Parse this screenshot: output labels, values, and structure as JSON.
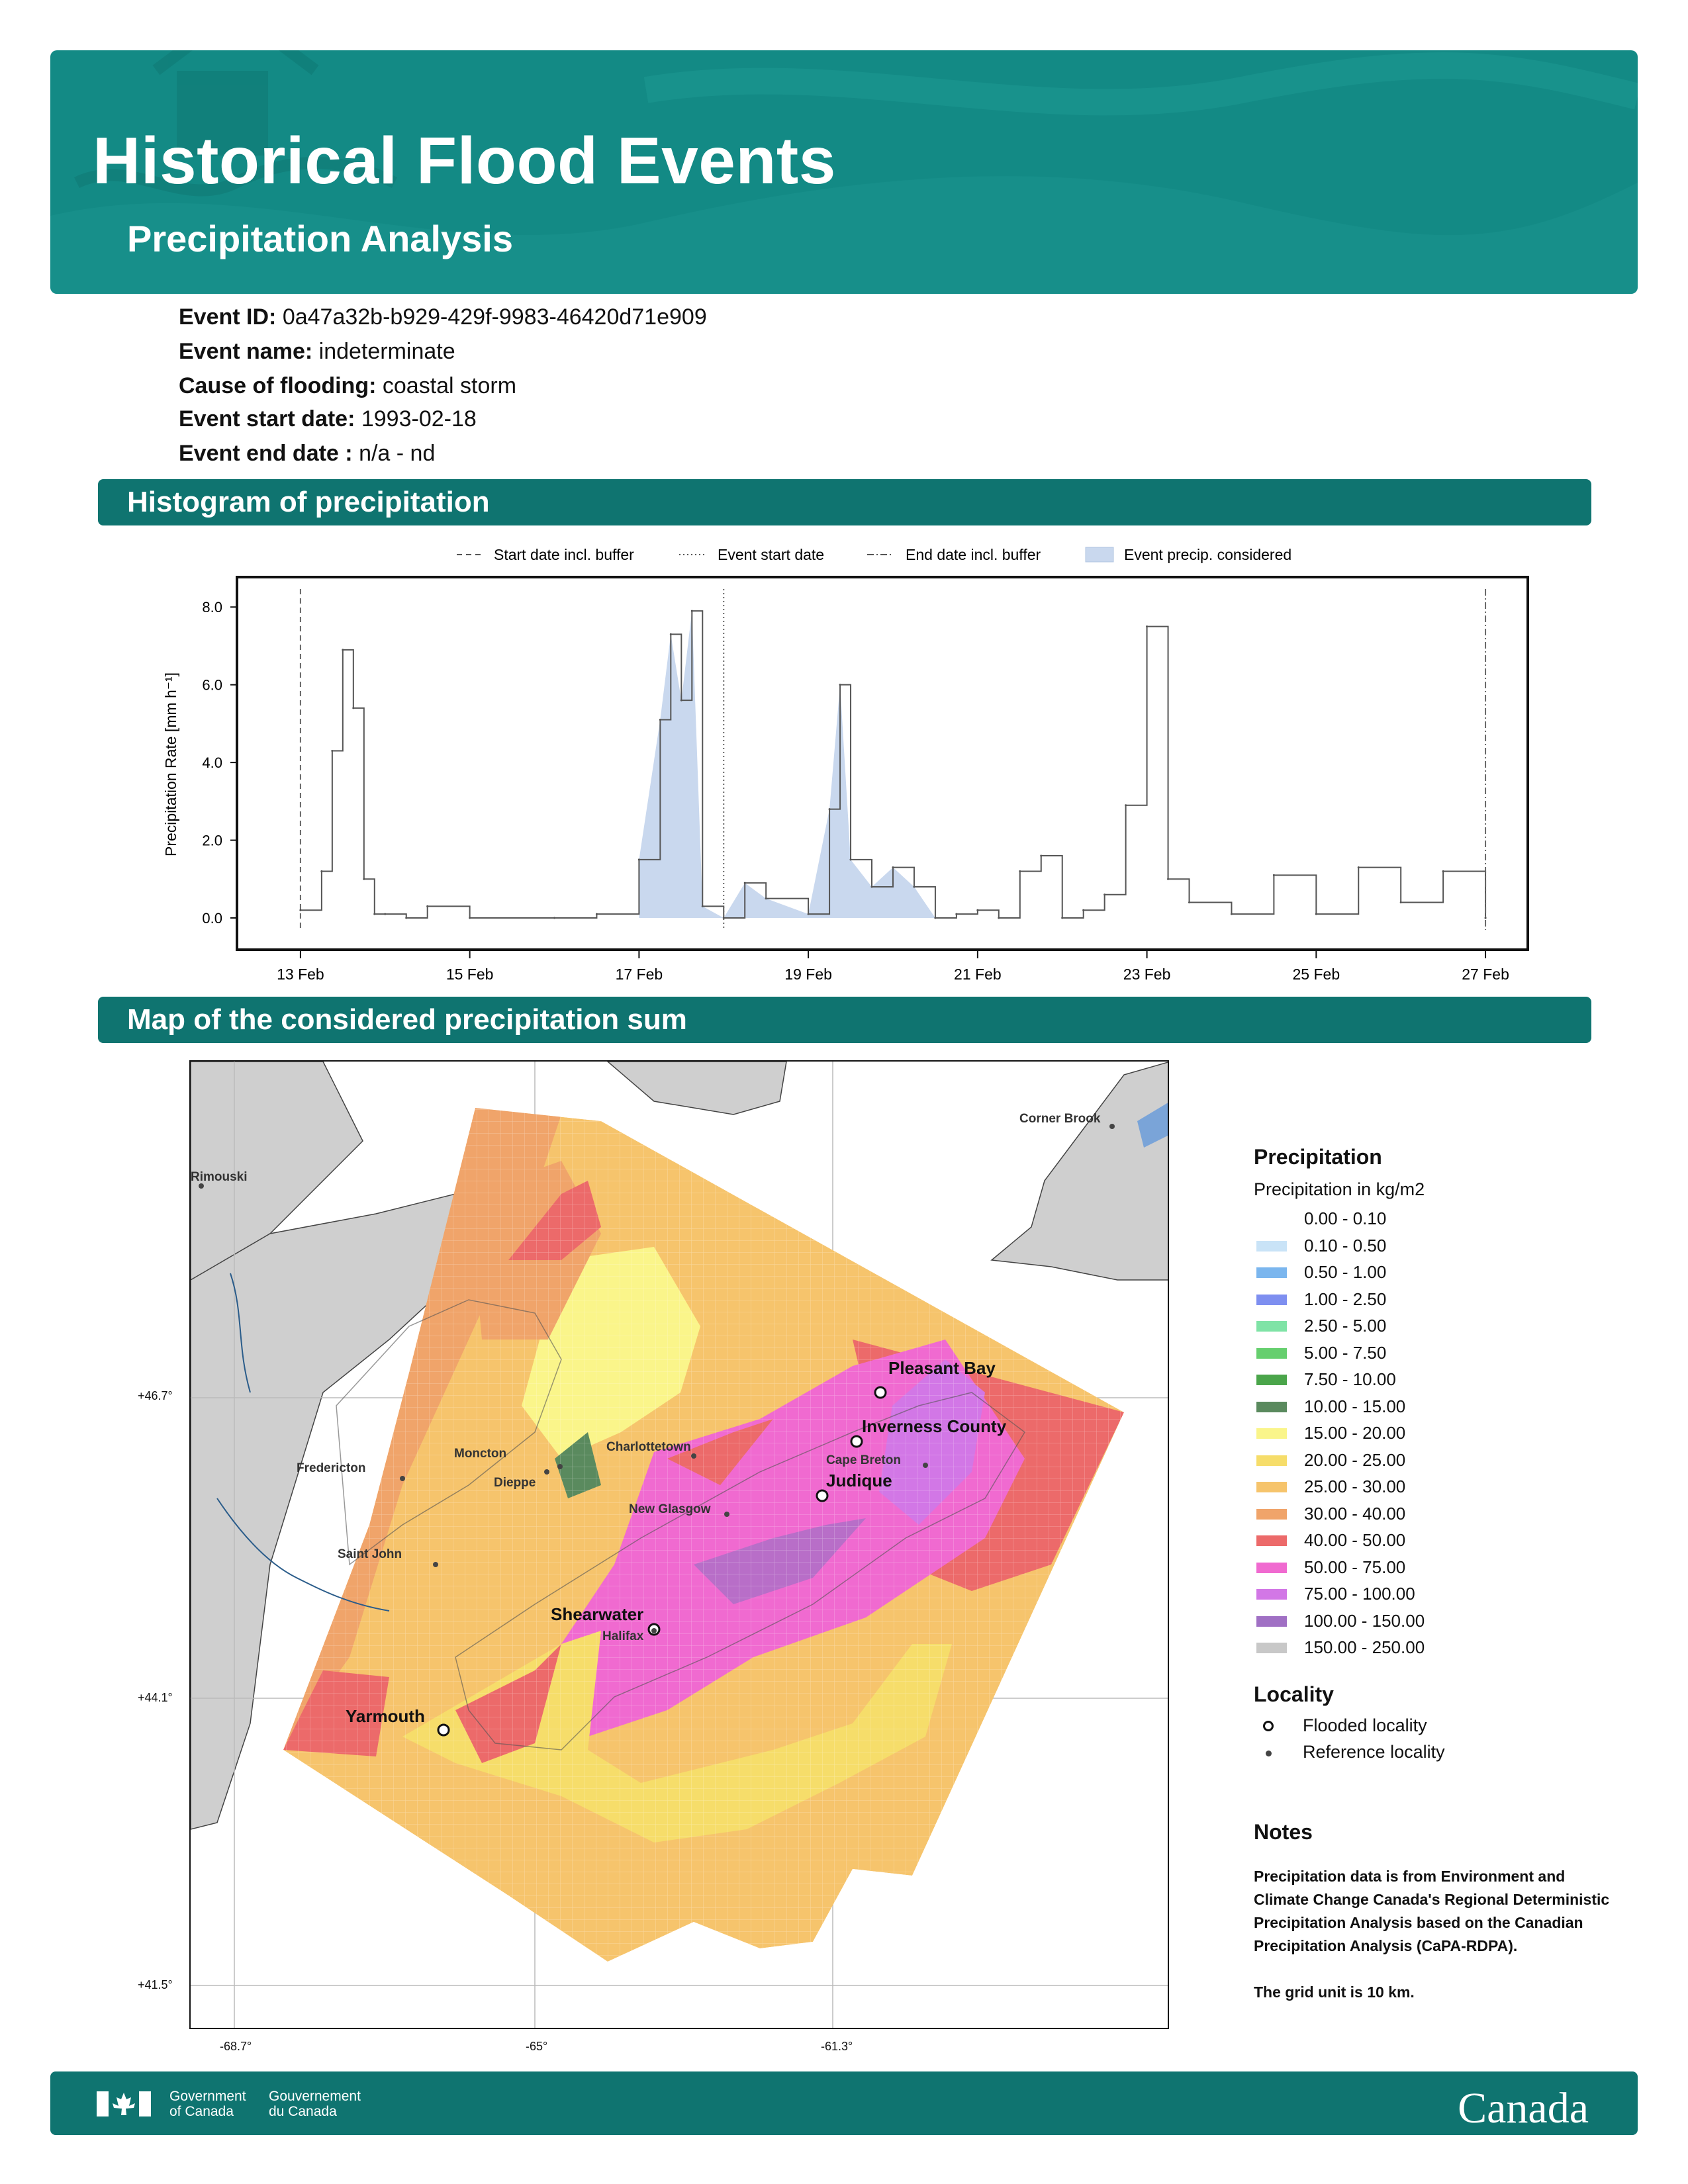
{
  "header": {
    "title": "Historical Flood Events",
    "subtitle": "Precipitation Analysis",
    "colors": {
      "banner": "#138a85",
      "section_bar": "#0f7470"
    }
  },
  "event": {
    "id_label": "Event ID:",
    "id_value": "0a47a32b-b929-429f-9983-46420d71e909",
    "name_label": "Event name:",
    "name_value": "indeterminate",
    "cause_label": "Cause of flooding:",
    "cause_value": "coastal storm",
    "start_label": "Event start date:",
    "start_value": "1993-02-18",
    "end_label": "Event end date :",
    "end_value": "n/a - nd"
  },
  "sections": {
    "histogram": "Histogram of precipitation",
    "map": "Map of the considered precipitation sum"
  },
  "chart_data": {
    "type": "line",
    "ylabel": "Precipitation Rate [mm h⁻¹]",
    "ylim": [
      0,
      8.6
    ],
    "yticks": [
      "0.0",
      "2.0",
      "4.0",
      "6.0",
      "8.0"
    ],
    "xticks": [
      "13 Feb",
      "15 Feb",
      "17 Feb",
      "19 Feb",
      "21 Feb",
      "23 Feb",
      "25 Feb",
      "27 Feb"
    ],
    "xlim": [
      "1993-02-12T06:00",
      "1993-02-27T12:00"
    ],
    "legend": [
      "Start date incl. buffer",
      "Event start date",
      "End date incl. buffer",
      "Event precip. considered"
    ],
    "vlines": {
      "start_buffer": "1993-02-13T00:00",
      "event_start": "1993-02-18T00:00",
      "end_buffer": "1993-02-27T00:00"
    },
    "considered_range": [
      "1993-02-17T00:00",
      "1993-02-20T12:00"
    ],
    "series": [
      {
        "x": [
          "1993-02-13T00:00",
          "1993-02-13T06:00",
          "1993-02-13T09:00",
          "1993-02-13T12:00",
          "1993-02-13T15:00",
          "1993-02-13T18:00",
          "1993-02-13T21:00",
          "1993-02-14T00:00",
          "1993-02-14T06:00",
          "1993-02-14T12:00",
          "1993-02-15T00:00",
          "1993-02-16T00:00",
          "1993-02-16T12:00",
          "1993-02-17T00:00",
          "1993-02-17T06:00",
          "1993-02-17T09:00",
          "1993-02-17T12:00",
          "1993-02-17T15:00",
          "1993-02-17T18:00",
          "1993-02-18T00:00",
          "1993-02-18T06:00",
          "1993-02-18T12:00",
          "1993-02-19T00:00",
          "1993-02-19T06:00",
          "1993-02-19T09:00",
          "1993-02-19T12:00",
          "1993-02-19T18:00",
          "1993-02-20T00:00",
          "1993-02-20T06:00",
          "1993-02-20T12:00",
          "1993-02-20T18:00",
          "1993-02-21T00:00",
          "1993-02-21T06:00",
          "1993-02-21T12:00",
          "1993-02-21T18:00",
          "1993-02-22T00:00",
          "1993-02-22T06:00",
          "1993-02-22T12:00",
          "1993-02-22T18:00",
          "1993-02-23T00:00",
          "1993-02-23T06:00",
          "1993-02-23T12:00",
          "1993-02-24T00:00",
          "1993-02-24T12:00",
          "1993-02-25T00:00",
          "1993-02-25T12:00",
          "1993-02-26T00:00",
          "1993-02-26T12:00",
          "1993-02-27T00:00"
        ],
        "y": [
          0.2,
          1.2,
          4.3,
          6.9,
          5.4,
          1.0,
          0.1,
          0.1,
          0.0,
          0.3,
          0.0,
          0.0,
          0.1,
          1.5,
          5.1,
          7.3,
          5.6,
          7.9,
          0.3,
          0.0,
          0.9,
          0.5,
          0.1,
          2.8,
          6.0,
          1.5,
          0.8,
          1.3,
          0.8,
          0.0,
          0.1,
          0.2,
          0.0,
          1.2,
          1.6,
          0.0,
          0.2,
          0.6,
          2.9,
          7.5,
          1.0,
          0.4,
          0.1,
          1.1,
          0.1,
          1.3,
          0.4,
          1.2,
          0.0
        ]
      }
    ]
  },
  "map": {
    "x_ticks": [
      "-68.7°",
      "-65°",
      "-61.3°"
    ],
    "y_ticks": [
      "+46.7°",
      "+44.1°",
      "+41.5°"
    ],
    "flooded": [
      "Pleasant Bay",
      "Inverness County",
      "Judique",
      "Shearwater",
      "Yarmouth"
    ],
    "reference": [
      "Corner Brook",
      "Rimouski",
      "Charlottetown",
      "Moncton",
      "Dieppe",
      "Fredericton",
      "Cape Breton",
      "New Glasgow",
      "Saint John",
      "Halifax"
    ]
  },
  "legend": {
    "title": "Precipitation",
    "subtitle": "Precipitation in kg/m2",
    "items": [
      {
        "label": "0.00 - 0.10",
        "color": "#ffffff"
      },
      {
        "label": "0.10 - 0.50",
        "color": "#c9e3f7"
      },
      {
        "label": "0.50 - 1.00",
        "color": "#7bb6ee"
      },
      {
        "label": "1.00 - 2.50",
        "color": "#7e8ff0"
      },
      {
        "label": "2.50 - 5.00",
        "color": "#7fe3a6"
      },
      {
        "label": "5.00 - 7.50",
        "color": "#66cf6e"
      },
      {
        "label": "7.50 - 10.00",
        "color": "#4aa54a"
      },
      {
        "label": "10.00 - 15.00",
        "color": "#5a8a5e"
      },
      {
        "label": "15.00 - 20.00",
        "color": "#faf58a"
      },
      {
        "label": "20.00 - 25.00",
        "color": "#f6dd6a"
      },
      {
        "label": "25.00 - 30.00",
        "color": "#f6c46c"
      },
      {
        "label": "30.00 - 40.00",
        "color": "#f0a46a"
      },
      {
        "label": "40.00 - 50.00",
        "color": "#ec6a6a"
      },
      {
        "label": "50.00 - 75.00",
        "color": "#f06ad0"
      },
      {
        "label": "75.00 - 100.00",
        "color": "#d277e6"
      },
      {
        "label": "100.00 - 150.00",
        "color": "#a070c4"
      },
      {
        "label": "150.00 - 250.00",
        "color": "#c8c8c8"
      }
    ],
    "locality_title": "Locality",
    "flooded_label": "Flooded locality",
    "reference_label": "Reference locality"
  },
  "notes": {
    "title": "Notes",
    "text1": "Precipitation data is from Environment and Climate Change Canada's Regional Deterministic Precipitation Analysis based on the Canadian Precipitation Analysis (CaPA-RDPA).",
    "text2": "The grid unit is 10 km."
  },
  "footer": {
    "gov_en_1": "Government",
    "gov_en_2": "of Canada",
    "gov_fr_1": "Gouvernement",
    "gov_fr_2": "du Canada",
    "wordmark": "Canada"
  }
}
